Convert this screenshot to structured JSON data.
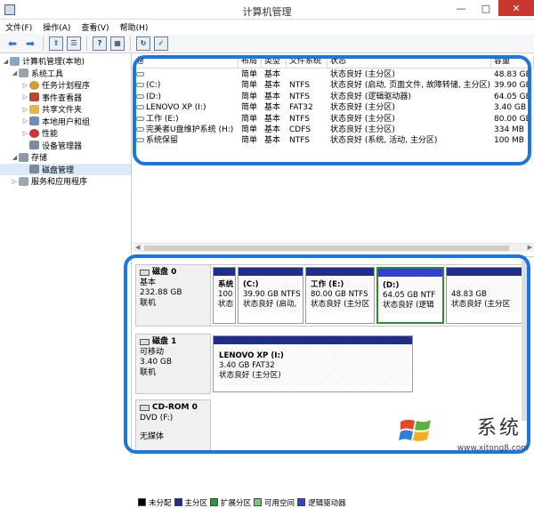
{
  "window": {
    "title": "计算机管理"
  },
  "menu": [
    "文件(F)",
    "操作(A)",
    "查看(V)",
    "帮助(H)"
  ],
  "tree": {
    "root": "计算机管理(本地)",
    "system_tools": "系统工具",
    "items": [
      "任务计划程序",
      "事件查看器",
      "共享文件夹",
      "本地用户和组",
      "性能",
      "设备管理器"
    ],
    "storage": "存储",
    "disk_management": "磁盘管理",
    "services": "服务和应用程序"
  },
  "volume_table": {
    "headers": [
      "卷",
      "布局",
      "类型",
      "文件系统",
      "状态",
      "容量"
    ],
    "rows": [
      {
        "vol": "",
        "layout": "简单",
        "type": "基本",
        "fs": "",
        "status": "状态良好 (主分区)",
        "size": "48.83 GB"
      },
      {
        "vol": "(C:)",
        "layout": "简单",
        "type": "基本",
        "fs": "NTFS",
        "status": "状态良好 (启动, 页面文件, 故障转储, 主分区)",
        "size": "39.90 GB"
      },
      {
        "vol": "(D:)",
        "layout": "简单",
        "type": "基本",
        "fs": "NTFS",
        "status": "状态良好 (逻辑驱动器)",
        "size": "64.05 GB"
      },
      {
        "vol": "LENOVO XP (I:)",
        "layout": "简单",
        "type": "基本",
        "fs": "FAT32",
        "status": "状态良好 (主分区)",
        "size": "3.40 GB"
      },
      {
        "vol": "工作 (E:)",
        "layout": "简单",
        "type": "基本",
        "fs": "NTFS",
        "status": "状态良好 (主分区)",
        "size": "80.00 GB"
      },
      {
        "vol": "完美者U盘维护系统 (H:)",
        "layout": "简单",
        "type": "基本",
        "fs": "CDFS",
        "status": "状态良好 (主分区)",
        "size": "334 MB"
      },
      {
        "vol": "系统保留",
        "layout": "简单",
        "type": "基本",
        "fs": "NTFS",
        "status": "状态良好 (系统, 活动, 主分区)",
        "size": "100 MB"
      }
    ]
  },
  "disks": [
    {
      "name": "磁盘 0",
      "type": "基本",
      "size": "232.88 GB",
      "state": "联机",
      "partitions": [
        {
          "l1": "系统",
          "l2": "100 I",
          "l3": "状态良",
          "logical": false
        },
        {
          "l1": "(C:)",
          "l2": "39.90 GB NTFS",
          "l3": "状态良好 (启动,",
          "logical": false
        },
        {
          "l1": "工作 (E:)",
          "l2": "80.00 GB NTFS",
          "l3": "状态良好 (主分区",
          "logical": false
        },
        {
          "l1": "(D:)",
          "l2": "64.05 GB NTF",
          "l3": "状态良好 (逻辑",
          "logical": true
        },
        {
          "l1": "",
          "l2": "48.83 GB",
          "l3": "状态良好 (主分区",
          "logical": false
        }
      ]
    },
    {
      "name": "磁盘 1",
      "type": "可移动",
      "size": "3.40 GB",
      "state": "联机",
      "partitions": [
        {
          "l1": "LENOVO XP  (I:)",
          "l2": "3.40 GB FAT32",
          "l3": "状态良好 (主分区)",
          "logical": false
        }
      ]
    },
    {
      "name": "CD-ROM 0",
      "type": "DVD (F:)",
      "state": "无媒体"
    }
  ],
  "legend": [
    "未分配",
    "主分区",
    "扩展分区",
    "可用空间",
    "逻辑驱动器"
  ],
  "legend_colors": [
    "#000000",
    "#1f2e8c",
    "#2e9a2e",
    "#7ec87e",
    "#3340d8"
  ],
  "watermark": {
    "text": "系统",
    "url": "www.xitong8.com"
  }
}
